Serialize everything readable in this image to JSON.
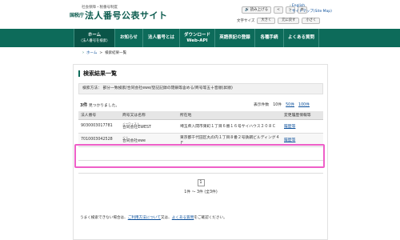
{
  "header": {
    "subtitle": "社会保障・税番号制度",
    "org": "国税庁",
    "site_title": "法人番号公表サイト",
    "read_aloud": "読み上げる",
    "back": "<",
    "forward": ">",
    "settings": "⚙",
    "links": [
      "English",
      "サイトマップ(Site Map)"
    ],
    "font_size_label": "文字サイズ",
    "font_sizes": [
      "大きく",
      "元に戻す",
      "小さく"
    ]
  },
  "nav": {
    "items": [
      {
        "label": "ホーム",
        "sub": "（法人番号を検索）"
      },
      {
        "label": "お知らせ",
        "sub": ""
      },
      {
        "label": "法人番号とは",
        "sub": ""
      },
      {
        "label": "ダウンロード",
        "sub": "Web-API"
      },
      {
        "label": "英語表記の登録",
        "sub": ""
      },
      {
        "label": "各種手続",
        "sub": ""
      },
      {
        "label": "よくある質問",
        "sub": ""
      }
    ]
  },
  "breadcrumb": {
    "home": "ホーム",
    "current": "検索結果一覧"
  },
  "results": {
    "title": "検索結果一覧",
    "conditions": "検索方法： 部分一致検索/合同会社ewe/登記記録の閉鎖等含める/商号等五十音順(昇順)",
    "count": "3件",
    "count_suffix": " 見つかりました。",
    "per_page_label": "表示件数",
    "per_page_options": [
      "10件",
      "50件",
      "100件"
    ],
    "columns": [
      "法人番号",
      "商号又は名称",
      "所在地",
      "変更履歴情報等"
    ],
    "rows": [
      {
        "number": "9030003017781",
        "furigana": "イーウェスト",
        "name": "合同会社EWEST",
        "address": "埼玉県入間市東町１丁目６番１６号サイハウス２０８Ｃ",
        "history": "履歴等"
      },
      {
        "number": "7010003042528",
        "furigana": "イー",
        "name": "合同会社ewe",
        "address": "東京都千代田区丸の内１丁目８番２号鉄鋼ビルディング４Ｆ",
        "history": "履歴等"
      },
      {
        "number": "",
        "furigana": "",
        "name": "",
        "address": "",
        "history": ""
      }
    ],
    "pager_current": "1",
    "pager_range": "1件 ～ 3件 (全3件)"
  },
  "note": {
    "prefix": "うまく検索できない場合は、",
    "link1": "ご利用方法について",
    "mid": "又は、",
    "link2": "よくある質問",
    "suffix": "をご確認ください。"
  },
  "colors": {
    "brand": "#0d6b5a",
    "highlight": "#ee5fc8",
    "link": "#0a4f9b"
  }
}
